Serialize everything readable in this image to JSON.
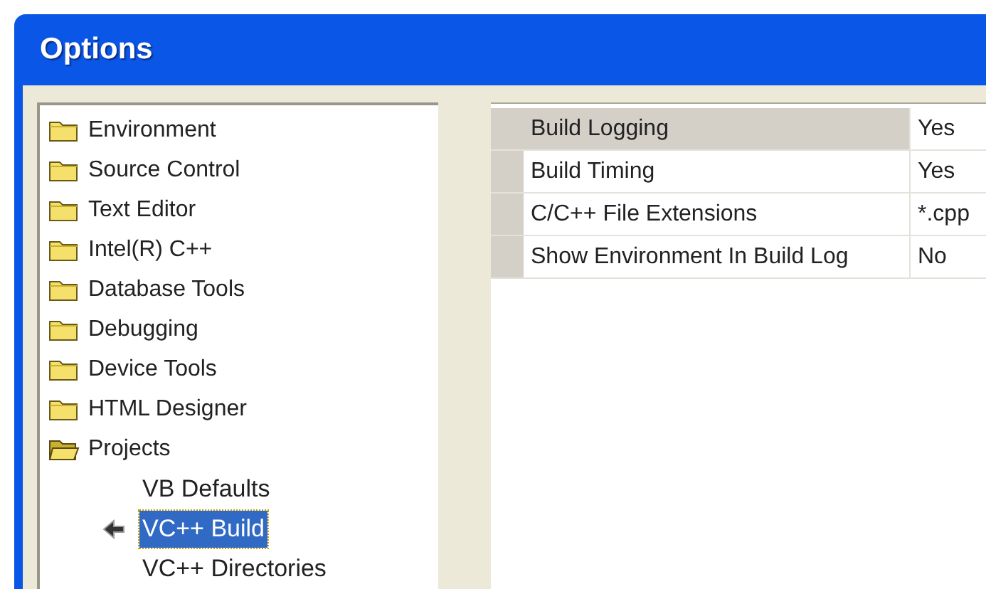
{
  "window": {
    "title": "Options"
  },
  "tree": [
    {
      "label": "Environment",
      "expanded": false
    },
    {
      "label": "Source Control",
      "expanded": false
    },
    {
      "label": "Text Editor",
      "expanded": false
    },
    {
      "label": "Intel(R) C++",
      "expanded": false
    },
    {
      "label": "Database Tools",
      "expanded": false
    },
    {
      "label": "Debugging",
      "expanded": false
    },
    {
      "label": "Device Tools",
      "expanded": false
    },
    {
      "label": "HTML Designer",
      "expanded": false
    },
    {
      "label": "Projects",
      "expanded": true,
      "children": [
        {
          "label": "VB Defaults",
          "selected": false
        },
        {
          "label": "VC++ Build",
          "selected": true
        },
        {
          "label": "VC++ Directories",
          "selected": false
        }
      ]
    }
  ],
  "properties": [
    {
      "name": "Build Logging",
      "value": "Yes",
      "selected": true
    },
    {
      "name": "Build Timing",
      "value": "Yes",
      "selected": false
    },
    {
      "name": "C/C++ File Extensions",
      "value": "*.cpp",
      "selected": false
    },
    {
      "name": "Show Environment In Build Log",
      "value": "No",
      "selected": false
    }
  ]
}
